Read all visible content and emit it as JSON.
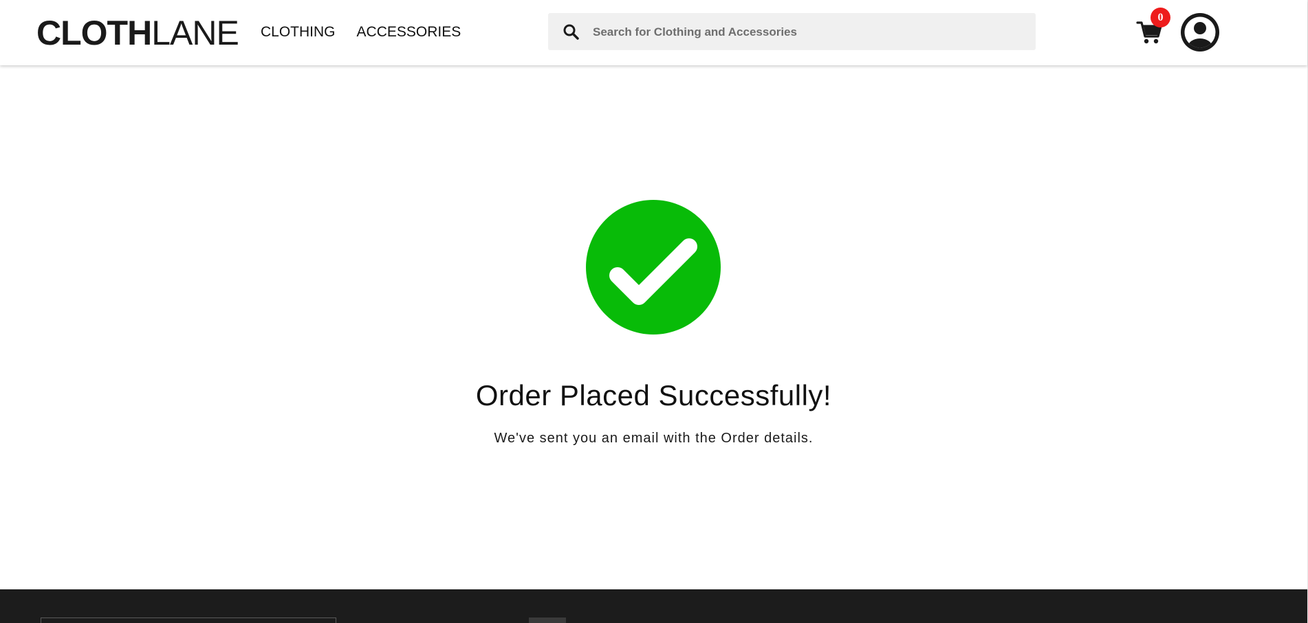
{
  "header": {
    "logo": {
      "bold": "CLOTH",
      "thin": "LANE"
    },
    "nav": [
      {
        "label": "CLOTHING"
      },
      {
        "label": "ACCESSORIES"
      }
    ],
    "search": {
      "placeholder": "Search for Clothing and Accessories",
      "value": "",
      "icon": "search-icon"
    },
    "cart": {
      "icon": "cart-icon",
      "count": "0",
      "badge_color": "#ee1c1c"
    },
    "account": {
      "icon": "user-avatar-icon"
    }
  },
  "main": {
    "status_icon": "check-circle-icon",
    "status_color": "#08bb08",
    "title": "Order Placed Successfully!",
    "message": "We've sent you an email with the Order details."
  },
  "footer": {
    "background": "#1c1c1c"
  }
}
